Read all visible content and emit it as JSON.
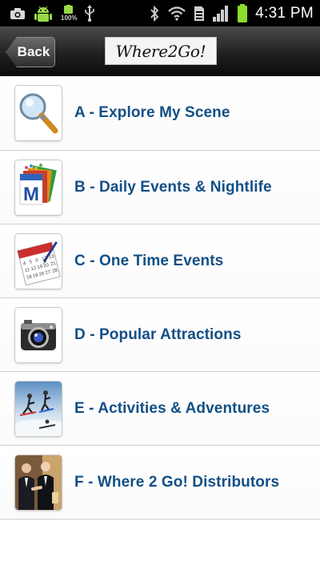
{
  "status_bar": {
    "battery_left_text": "100%",
    "time": "4:31 PM",
    "icons": [
      "camera-icon",
      "android-icon",
      "usb-icon",
      "bluetooth-icon",
      "wifi-icon",
      "sim-icon",
      "signal-icon",
      "battery-icon"
    ]
  },
  "header": {
    "back_label": "Back",
    "logo_text": "Where2Go!"
  },
  "menu": {
    "items": [
      {
        "label": "A - Explore My Scene",
        "icon": "magnifier-icon"
      },
      {
        "label": "B - Daily Events & Nightlife",
        "icon": "calendar-pages-icon"
      },
      {
        "label": "C - One Time Events",
        "icon": "calendar-icon"
      },
      {
        "label": "D - Popular Attractions",
        "icon": "camera-icon"
      },
      {
        "label": "E - Activities & Adventures",
        "icon": "skiers-photo-icon"
      },
      {
        "label": "F - Where 2 Go! Distributors",
        "icon": "handshake-photo-icon"
      }
    ]
  },
  "colors": {
    "accent": "#124f86",
    "header_bg": "#1e1e1e",
    "status_bg": "#000000",
    "battery": "#8bdc2b"
  }
}
